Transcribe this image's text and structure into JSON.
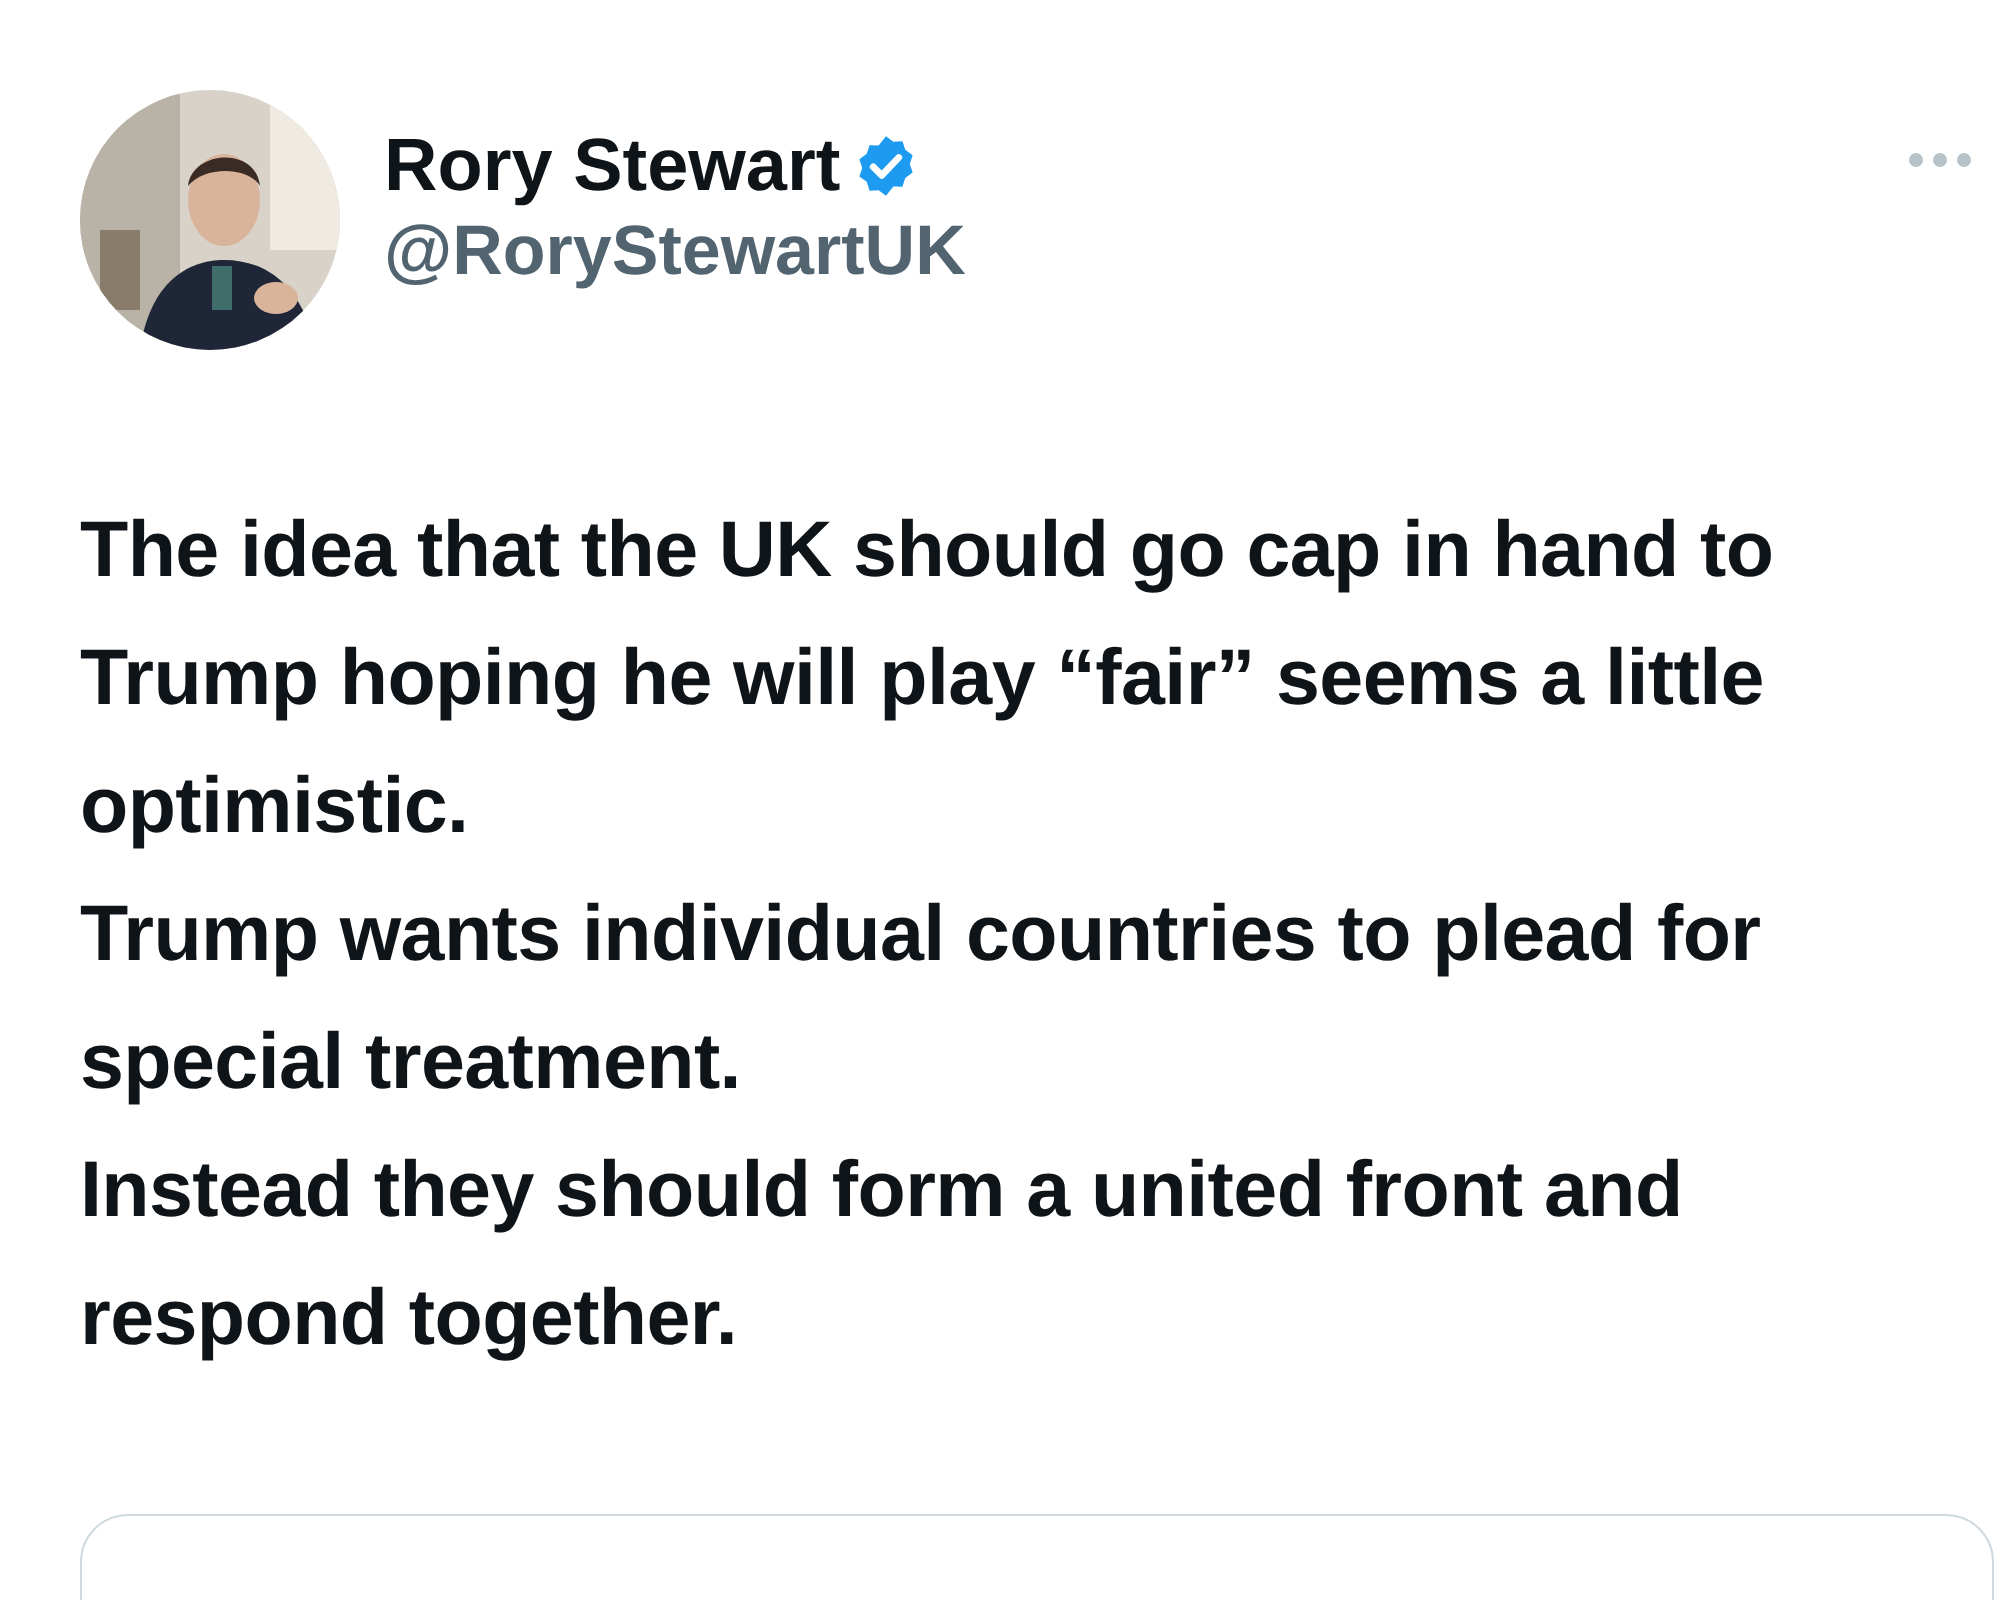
{
  "author": {
    "name": "Rory Stewart",
    "verified": true,
    "handle": "@RoryStewartUK"
  },
  "tweet": {
    "paragraphs": [
      "The idea that the UK should go cap in hand to Trump hoping he will play “fair” seems a little optimistic.",
      "Trump wants individual countries to plead for special treatment.",
      "Instead they should form a united front and respond together."
    ]
  }
}
